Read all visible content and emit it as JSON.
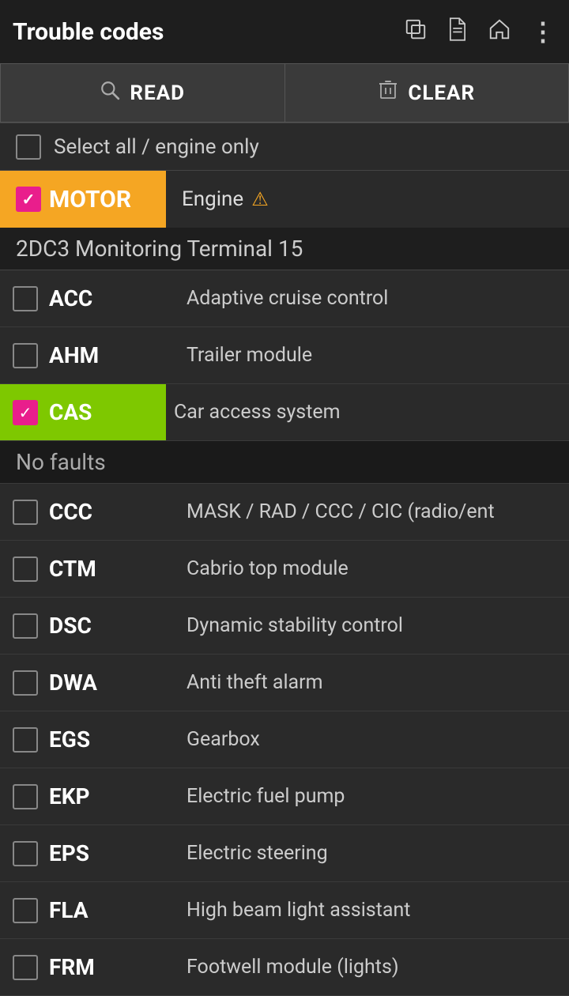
{
  "header": {
    "title": "Trouble codes",
    "icons": [
      {
        "name": "copy-icon",
        "glyph": "⧉"
      },
      {
        "name": "document-icon",
        "glyph": "📄"
      },
      {
        "name": "home-icon",
        "glyph": "🏠"
      },
      {
        "name": "more-icon",
        "glyph": "⋮"
      }
    ]
  },
  "toolbar": {
    "read_label": "READ",
    "clear_label": "CLEAR"
  },
  "select_all": {
    "label": "Select all / engine only"
  },
  "motor_section": {
    "code": "MOTOR",
    "description": "Engine",
    "checked": true
  },
  "dtc_header": {
    "code": "2DC3 Monitoring Terminal 15"
  },
  "items": [
    {
      "code": "ACC",
      "description": "Adaptive cruise control",
      "checked": false,
      "cas": false,
      "no_faults": false
    },
    {
      "code": "AHM",
      "description": "Trailer module",
      "checked": false,
      "cas": false,
      "no_faults": false
    },
    {
      "code": "CAS",
      "description": "Car access system",
      "checked": true,
      "cas": true,
      "no_faults": false
    },
    {
      "code": "CCC",
      "description": "MASK / RAD / CCC / CIC (radio/ent",
      "checked": false,
      "cas": false,
      "no_faults": true
    },
    {
      "code": "CTM",
      "description": "Cabrio top module",
      "checked": false,
      "cas": false,
      "no_faults": false
    },
    {
      "code": "DSC",
      "description": "Dynamic stability control",
      "checked": false,
      "cas": false,
      "no_faults": false
    },
    {
      "code": "DWA",
      "description": "Anti theft alarm",
      "checked": false,
      "cas": false,
      "no_faults": false
    },
    {
      "code": "EGS",
      "description": "Gearbox",
      "checked": false,
      "cas": false,
      "no_faults": false
    },
    {
      "code": "EKP",
      "description": "Electric fuel pump",
      "checked": false,
      "cas": false,
      "no_faults": false
    },
    {
      "code": "EPS",
      "description": "Electric steering",
      "checked": false,
      "cas": false,
      "no_faults": false
    },
    {
      "code": "FLA",
      "description": "High beam light assistant",
      "checked": false,
      "cas": false,
      "no_faults": false
    },
    {
      "code": "FRM",
      "description": "Footwell module (lights)",
      "checked": false,
      "cas": false,
      "no_faults": false
    }
  ],
  "no_faults_label": "No faults"
}
